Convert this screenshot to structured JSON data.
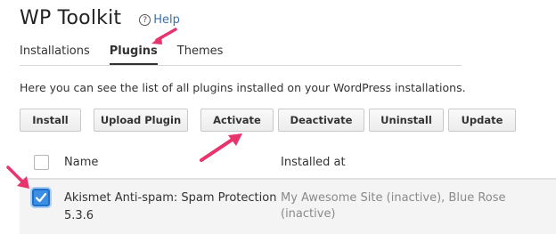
{
  "header": {
    "title": "WP Toolkit",
    "help_label": "Help"
  },
  "tabs": [
    {
      "label": "Installations",
      "active": false
    },
    {
      "label": "Plugins",
      "active": true
    },
    {
      "label": "Themes",
      "active": false
    }
  ],
  "description": "Here you can see the list of all plugins installed on your WordPress installations.",
  "toolbar": {
    "install": "Install",
    "upload_plugin": "Upload Plugin",
    "activate": "Activate",
    "deactivate": "Deactivate",
    "uninstall": "Uninstall",
    "update": "Update"
  },
  "table": {
    "columns": {
      "name": "Name",
      "installed_at": "Installed at"
    },
    "rows": [
      {
        "name": "Akismet Anti-spam: Spam Protection",
        "version": "5.3.6",
        "installed_at": "My Awesome Site (inactive), Blue Rose (inactive)",
        "checked": true
      }
    ]
  },
  "colors": {
    "annotation_arrow": "#e8336d",
    "checkbox_checked": "#3c8ee3",
    "link": "#3a6fb0"
  },
  "icons": {
    "help": "question-circle-icon",
    "checkmark": "checkmark-icon",
    "annotation": "pink-arrow-icon"
  }
}
